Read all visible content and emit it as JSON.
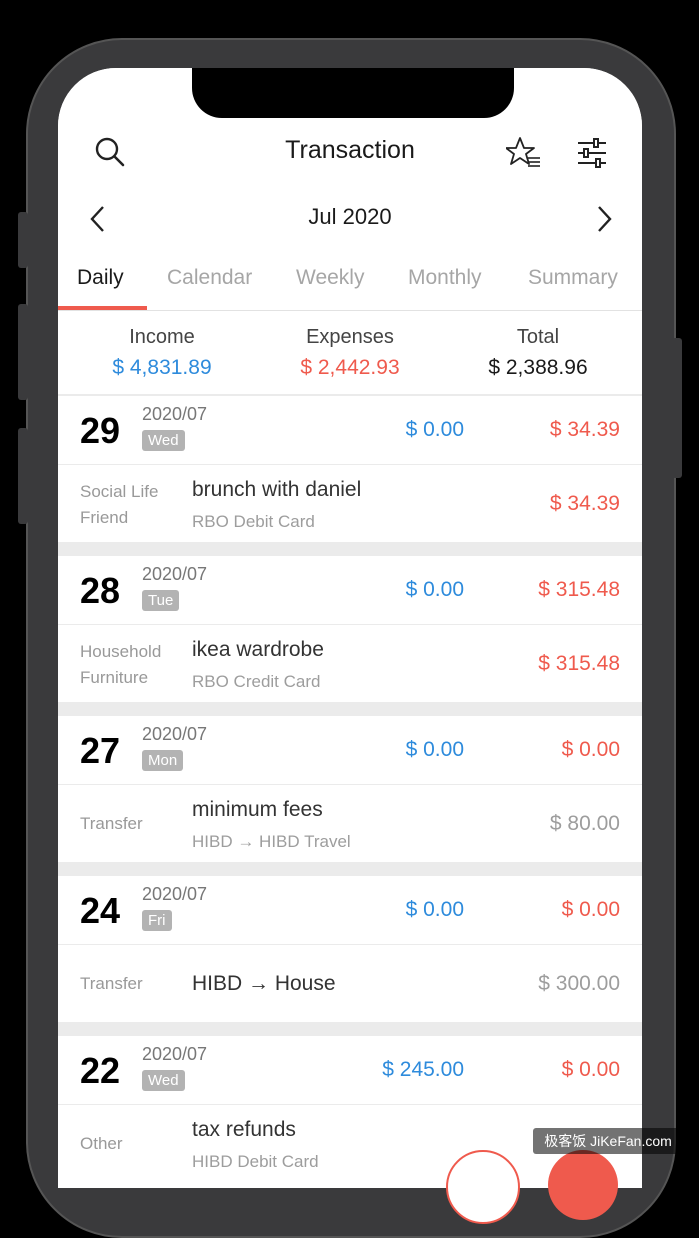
{
  "header": {
    "title": "Transaction",
    "month": "Jul 2020",
    "icons": {
      "search": "search-icon",
      "favorites": "star-list-icon",
      "filter": "sliders-icon",
      "prev": "chevron-left-icon",
      "next": "chevron-right-icon"
    }
  },
  "tabs": [
    {
      "label": "Daily",
      "active": true
    },
    {
      "label": "Calendar",
      "active": false
    },
    {
      "label": "Weekly",
      "active": false
    },
    {
      "label": "Monthly",
      "active": false
    },
    {
      "label": "Summary",
      "active": false
    }
  ],
  "summary": {
    "income_label": "Income",
    "income_value": "$ 4,831.89",
    "expenses_label": "Expenses",
    "expenses_value": "$ 2,442.93",
    "total_label": "Total",
    "total_value": "$ 2,388.96"
  },
  "days": [
    {
      "day": "29",
      "ym": "2020/07",
      "weekday": "Wed",
      "income": "$ 0.00",
      "expense": "$ 34.39",
      "tx": {
        "cat1": "Social Life",
        "cat2": "Friend",
        "title": "brunch with daniel",
        "account": "RBO Debit Card",
        "amount": "$ 34.39",
        "type": "expense"
      }
    },
    {
      "day": "28",
      "ym": "2020/07",
      "weekday": "Tue",
      "income": "$ 0.00",
      "expense": "$ 315.48",
      "tx": {
        "cat1": "Household",
        "cat2": "Furniture",
        "title": "ikea wardrobe",
        "account": "RBO Credit Card",
        "amount": "$ 315.48",
        "type": "expense"
      }
    },
    {
      "day": "27",
      "ym": "2020/07",
      "weekday": "Mon",
      "income": "$ 0.00",
      "expense": "$ 0.00",
      "tx": {
        "cat1": "Transfer",
        "cat2": "",
        "title": "minimum fees",
        "account": "HIBD → HIBD Travel",
        "amount": "$ 80.00",
        "type": "transfer"
      }
    },
    {
      "day": "24",
      "ym": "2020/07",
      "weekday": "Fri",
      "income": "$ 0.00",
      "expense": "$ 0.00",
      "tx": {
        "cat1": "Transfer",
        "cat2": "",
        "title": "HIBD → House",
        "account": "",
        "amount": "$ 300.00",
        "type": "transfer"
      }
    },
    {
      "day": "22",
      "ym": "2020/07",
      "weekday": "Wed",
      "income": "$ 245.00",
      "expense": "$ 0.00",
      "tx": {
        "cat1": "Other",
        "cat2": "",
        "title": "tax refunds",
        "account": "HIBD Debit Card",
        "amount": "",
        "type": "income"
      }
    }
  ],
  "watermark": "极客饭 JiKeFan.com",
  "colors": {
    "income": "#2e8bdc",
    "expense": "#ef5a4d",
    "accent": "#ef5a4d",
    "muted": "#9d9d9d"
  }
}
